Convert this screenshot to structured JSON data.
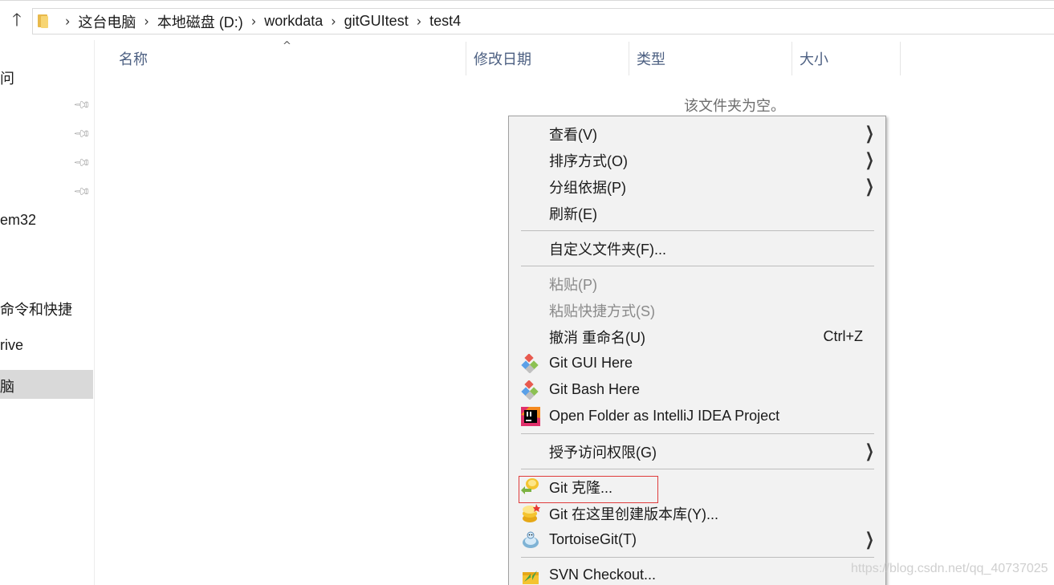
{
  "address_bar": {
    "up_icon": "up-arrow-icon",
    "folder_icon": "folder-icon",
    "breadcrumbs": [
      "这台电脑",
      "本地磁盘 (D:)",
      "workdata",
      "gitGUItest",
      "test4"
    ]
  },
  "nav_pane": {
    "items": [
      "问",
      "em32",
      "命令和快捷",
      "rive",
      "脑"
    ],
    "pin_icon": "pin-icon"
  },
  "columns": {
    "name": "名称",
    "modified": "修改日期",
    "type": "类型",
    "size": "大小"
  },
  "empty_message": "该文件夹为空。",
  "context_menu": {
    "items": [
      {
        "label": "查看(V)",
        "submenu": true
      },
      {
        "label": "排序方式(O)",
        "submenu": true
      },
      {
        "label": "分组依据(P)",
        "submenu": true
      },
      {
        "label": "刷新(E)"
      },
      {
        "label": "自定义文件夹(F)..."
      },
      {
        "label": "粘贴(P)",
        "disabled": true
      },
      {
        "label": "粘贴快捷方式(S)",
        "disabled": true
      },
      {
        "label": "撤消 重命名(U)",
        "shortcut": "Ctrl+Z"
      },
      {
        "label": "Git GUI Here",
        "icon": "git-gui-icon"
      },
      {
        "label": "Git Bash Here",
        "icon": "git-bash-icon"
      },
      {
        "label": "Open Folder as IntelliJ IDEA Project",
        "icon": "intellij-icon"
      },
      {
        "label": "授予访问权限(G)",
        "submenu": true
      },
      {
        "label": "Git 克隆...",
        "icon": "tortoisegit-clone-icon",
        "highlighted": true
      },
      {
        "label": "Git 在这里创建版本库(Y)...",
        "icon": "tortoisegit-create-repo-icon"
      },
      {
        "label": "TortoiseGit(T)",
        "icon": "tortoisegit-icon",
        "submenu": true
      },
      {
        "label": "SVN Checkout...",
        "icon": "svn-checkout-icon"
      }
    ],
    "submenu_arrow": "chevron-right-icon"
  },
  "watermark": "https://blog.csdn.net/qq_40737025",
  "colors": {
    "highlight_border": "#e03c3c",
    "menu_bg": "#f2f2f2",
    "nav_selected": "#d9d9d9",
    "header_text": "#4d6082"
  }
}
